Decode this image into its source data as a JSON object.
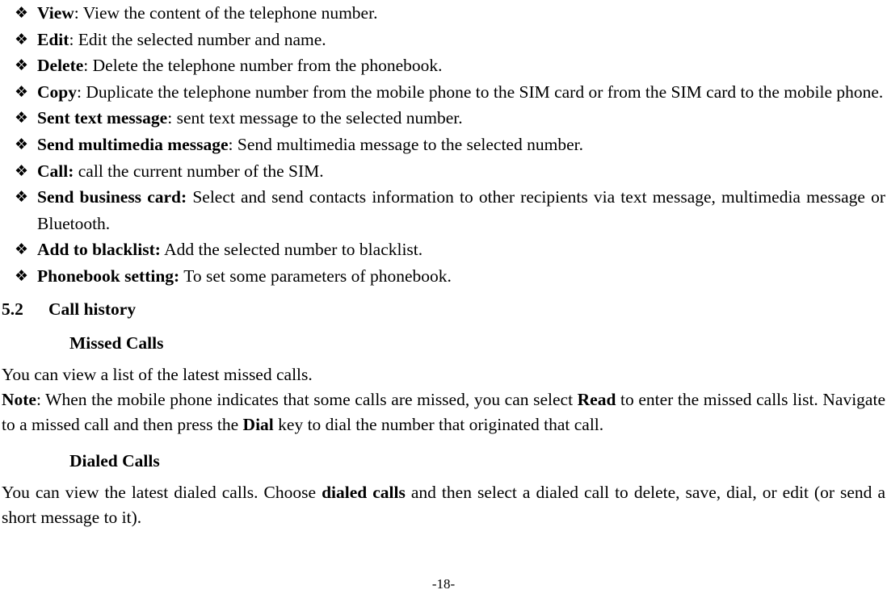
{
  "bullets": [
    {
      "glyph": "❖",
      "term": "View",
      "sep": ": ",
      "text": "View the content of the telephone number."
    },
    {
      "glyph": "❖",
      "term": "Edit",
      "sep": ": ",
      "text": "Edit the selected number and name."
    },
    {
      "glyph": "❖",
      "term": "Delete",
      "sep": ": ",
      "text": "Delete the telephone number from the phonebook."
    },
    {
      "glyph": "❖",
      "term": "Copy",
      "sep": ": ",
      "text": "Duplicate the telephone number from the mobile phone to the SIM card or from the SIM card to the mobile phone."
    },
    {
      "glyph": "❖",
      "term": "Sent text message",
      "sep": ": ",
      "text": "sent text message to the selected number."
    },
    {
      "glyph": "❖",
      "term": "Send multimedia message",
      "sep": ": ",
      "text": "Send multimedia message to the selected number."
    },
    {
      "glyph": "❖",
      "term": "Call:",
      "sep": " ",
      "text": "call the current number of the SIM."
    },
    {
      "glyph": "❖",
      "term": "Send business card:",
      "sep": " ",
      "text": "Select and send contacts information to other recipients via text message, multimedia message or Bluetooth."
    },
    {
      "glyph": "❖",
      "term": "Add to blacklist:",
      "sep": " ",
      "text": "Add the selected number to blacklist."
    },
    {
      "glyph": "❖",
      "term": "Phonebook setting:",
      "sep": " ",
      "text": "To set some parameters of phonebook."
    }
  ],
  "section": {
    "number": "5.2",
    "title": "Call history"
  },
  "missed": {
    "heading": "Missed Calls",
    "para1": "You can view a list of the latest missed calls.",
    "note_label": "Note",
    "note_part1": ": When the mobile phone indicates that some calls are missed, you can select ",
    "note_bold1": "Read",
    "note_part2": " to enter the missed calls list. Navigate to a missed call and then press the ",
    "note_bold2": "Dial",
    "note_part3": " key to dial the number that originated that call."
  },
  "dialed": {
    "heading": "Dialed Calls",
    "para_part1": "You can view the latest dialed calls. Choose ",
    "para_bold": "dialed calls",
    "para_part2": " and then select a dialed call to delete, save, dial, or edit (or send a short message to it)."
  },
  "footer": {
    "page_number": "-18-"
  }
}
